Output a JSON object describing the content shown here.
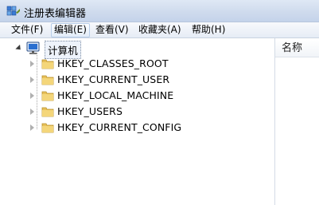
{
  "window": {
    "title": "注册表编辑器",
    "icon": "regedit-icon"
  },
  "menu": {
    "items": [
      {
        "label": "文件(F)"
      },
      {
        "label": "编辑(E)",
        "active": true
      },
      {
        "label": "查看(V)"
      },
      {
        "label": "收藏夹(A)"
      },
      {
        "label": "帮助(H)"
      }
    ]
  },
  "tree": {
    "root": {
      "label": "计算机",
      "icon": "computer-icon",
      "expanded": true,
      "selected": true
    },
    "hives": [
      {
        "label": "HKEY_CLASSES_ROOT",
        "icon": "folder-icon"
      },
      {
        "label": "HKEY_CURRENT_USER",
        "icon": "folder-icon"
      },
      {
        "label": "HKEY_LOCAL_MACHINE",
        "icon": "folder-icon"
      },
      {
        "label": "HKEY_USERS",
        "icon": "folder-icon"
      },
      {
        "label": "HKEY_CURRENT_CONFIG",
        "icon": "folder-icon"
      }
    ]
  },
  "values_pane": {
    "column_header": "名称"
  },
  "colors": {
    "folder": "#e8c15a",
    "titlebar": "#cfdbed",
    "selection": "#eef3fb"
  }
}
